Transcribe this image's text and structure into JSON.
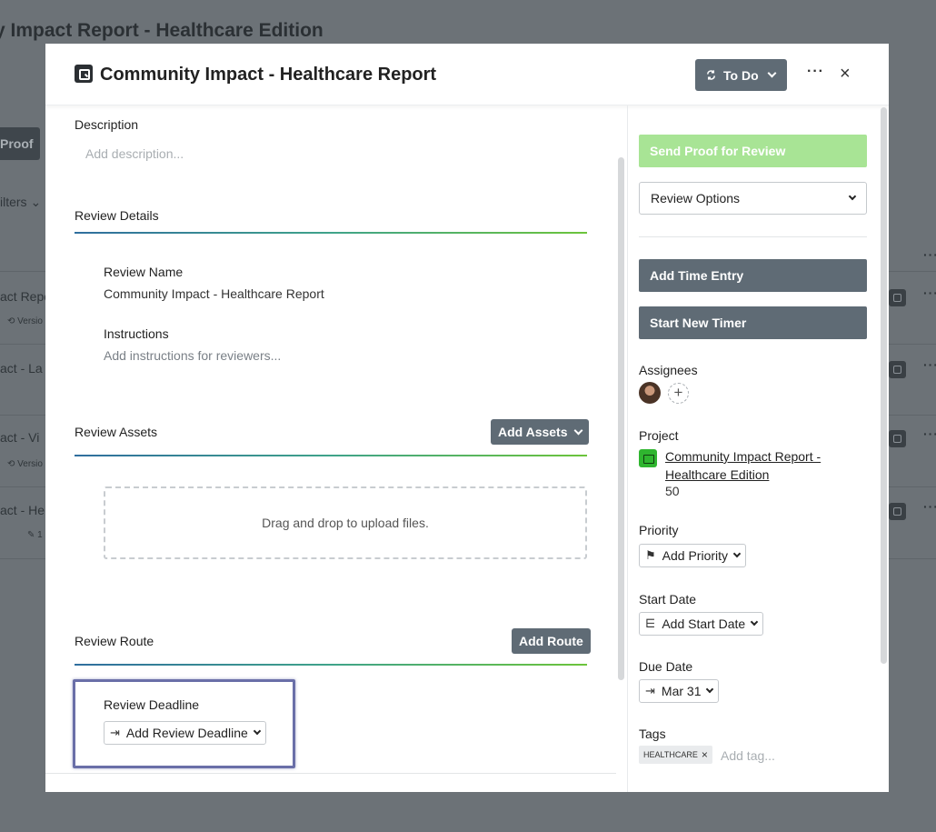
{
  "background": {
    "title": "y Impact Report - Healthcare Edition",
    "button_label": "Proof",
    "filters_label": "ilters",
    "rows": [
      {
        "label": "act Repo",
        "sub": "Versio"
      },
      {
        "label": "act - La",
        "sub": ""
      },
      {
        "label": "act - Vi",
        "sub": "Versio"
      },
      {
        "label": "act - He",
        "sub": "1"
      }
    ]
  },
  "modal": {
    "title": "Community Impact - Healthcare Report",
    "status": "To Do",
    "more": "···",
    "close": "×"
  },
  "left": {
    "description_label": "Description",
    "description_placeholder": "Add description...",
    "review_details_heading": "Review Details",
    "review_name_label": "Review Name",
    "review_name_value": "Community Impact - Healthcare Report",
    "instructions_label": "Instructions",
    "instructions_placeholder": "Add instructions for reviewers...",
    "review_assets_heading": "Review Assets",
    "add_assets_label": "Add Assets",
    "dropzone_text": "Drag and drop to upload files.",
    "review_route_heading": "Review Route",
    "add_route_label": "Add Route",
    "review_deadline_label": "Review Deadline",
    "add_review_deadline_label": "Add Review Deadline"
  },
  "right": {
    "send_proof_label": "Send Proof for Review",
    "review_options_label": "Review Options",
    "add_time_entry_label": "Add Time Entry",
    "start_new_timer_label": "Start New Timer",
    "assignees_label": "Assignees",
    "project_label": "Project",
    "project_name": "Community Impact Report - Healthcare Edition",
    "project_number": "50",
    "priority_label": "Priority",
    "add_priority_label": "Add Priority",
    "start_date_label": "Start Date",
    "add_start_date_label": "Add Start Date",
    "due_date_label": "Due Date",
    "due_date_value": "Mar 31",
    "tags_label": "Tags",
    "tag": "HEALTHCARE",
    "add_tag_placeholder": "Add tag..."
  },
  "colors": {
    "send_button": "#a8e495",
    "dark_button": "#5f6b75",
    "project_icon": "#2fb52f",
    "highlight_border": "#6a6fa8"
  }
}
